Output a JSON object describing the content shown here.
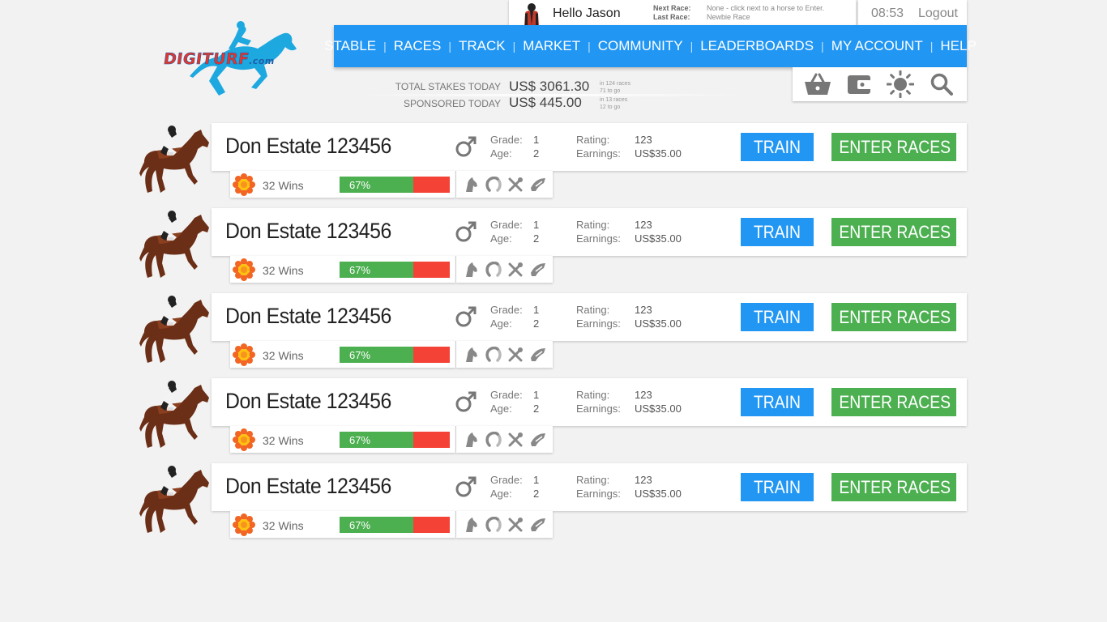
{
  "logo": {
    "text": "DIGITURF",
    "suffix": ".com"
  },
  "user": {
    "greeting": "Hello Jason",
    "next_race_label": "Next Race:",
    "next_race_value": "None - click  next to a horse to Enter.",
    "last_race_label": "Last Race:",
    "last_race_value": "Newbie Race"
  },
  "topbar": {
    "time": "08:53",
    "logout": "Logout"
  },
  "nav": [
    "STABLE",
    "RACES",
    "TRACK",
    "MARKET",
    "COMMUNITY",
    "LEADERBOARDS",
    "MY ACCOUNT",
    "HELP"
  ],
  "stakes": {
    "total_label": "TOTAL STAKES TODAY",
    "total_amount": "US$ 3061.30",
    "total_note1": "in 124 races",
    "total_note2": "71 to go",
    "sponsored_label": "SPONSORED TODAY",
    "sponsored_amount": "US$ 445.00",
    "sponsored_note1": "in 13 races",
    "sponsored_note2": "12 to go"
  },
  "tools": [
    "basket-icon",
    "wallet-icon",
    "brightness-icon",
    "search-icon"
  ],
  "horses": [
    {
      "name": "Don Estate 123456",
      "grade_label": "Grade:",
      "grade": "1",
      "age_label": "Age:",
      "age": "2",
      "rating_label": "Rating:",
      "rating": "123",
      "earnings_label": "Earnings:",
      "earnings": "US$35.00",
      "wins": "32 Wins",
      "win_pct": "67%",
      "win_fraction": 0.67,
      "train": "TRAIN",
      "enter": "ENTER RACES"
    },
    {
      "name": "Don Estate 123456",
      "grade_label": "Grade:",
      "grade": "1",
      "age_label": "Age:",
      "age": "2",
      "rating_label": "Rating:",
      "rating": "123",
      "earnings_label": "Earnings:",
      "earnings": "US$35.00",
      "wins": "32 Wins",
      "win_pct": "67%",
      "win_fraction": 0.67,
      "train": "TRAIN",
      "enter": "ENTER RACES"
    },
    {
      "name": "Don Estate 123456",
      "grade_label": "Grade:",
      "grade": "1",
      "age_label": "Age:",
      "age": "2",
      "rating_label": "Rating:",
      "rating": "123",
      "earnings_label": "Earnings:",
      "earnings": "US$35.00",
      "wins": "32 Wins",
      "win_pct": "67%",
      "win_fraction": 0.67,
      "train": "TRAIN",
      "enter": "ENTER RACES"
    },
    {
      "name": "Don Estate 123456",
      "grade_label": "Grade:",
      "grade": "1",
      "age_label": "Age:",
      "age": "2",
      "rating_label": "Rating:",
      "rating": "123",
      "earnings_label": "Earnings:",
      "earnings": "US$35.00",
      "wins": "32 Wins",
      "win_pct": "67%",
      "win_fraction": 0.67,
      "train": "TRAIN",
      "enter": "ENTER RACES"
    },
    {
      "name": "Don Estate 123456",
      "grade_label": "Grade:",
      "grade": "1",
      "age_label": "Age:",
      "age": "2",
      "rating_label": "Rating:",
      "rating": "123",
      "earnings_label": "Earnings:",
      "earnings": "US$35.00",
      "wins": "32 Wins",
      "win_pct": "67%",
      "win_fraction": 0.67,
      "train": "TRAIN",
      "enter": "ENTER RACES"
    }
  ],
  "colors": {
    "nav_blue": "#2196f3",
    "train_blue": "#2196f3",
    "enter_green": "#4caf50",
    "bar_green": "#4caf50",
    "bar_red": "#f44336",
    "logo_cyan": "#1ea8e0",
    "logo_red": "#e8342a"
  }
}
